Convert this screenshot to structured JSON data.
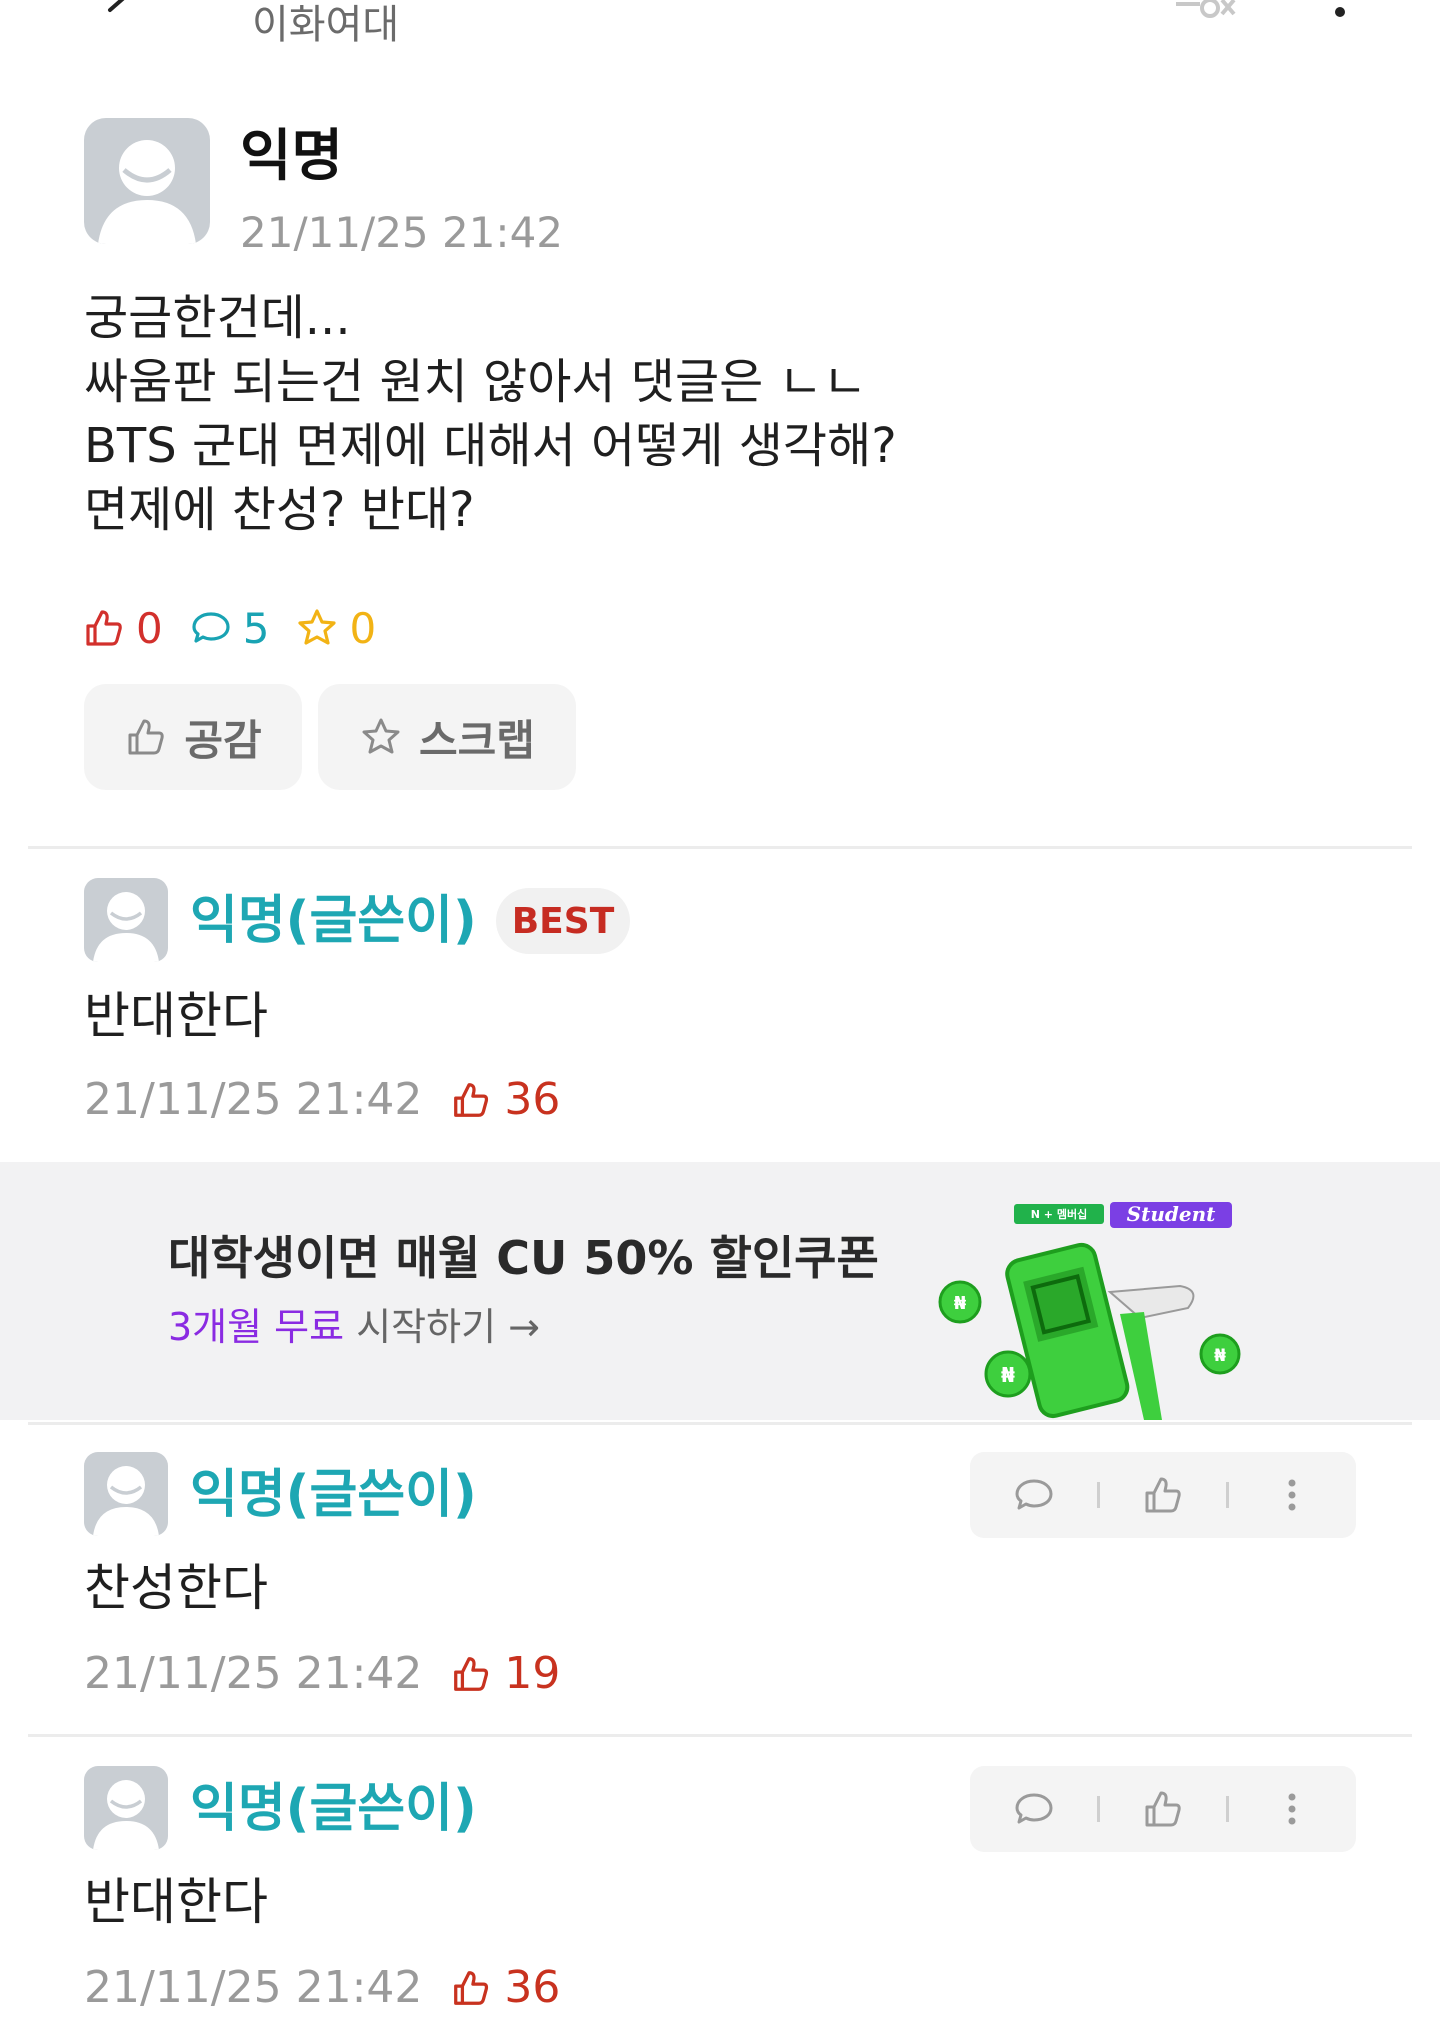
{
  "header": {
    "board_title": "이화여대"
  },
  "post": {
    "author": "익명",
    "date": "21/11/25 21:42",
    "body_lines": [
      "궁금한건데...",
      "싸움판 되는건 원치 않아서 댓글은 ㄴㄴ",
      "BTS 군대 면제에 대해서 어떻게 생각해?",
      "면제에 찬성? 반대?"
    ],
    "stats": {
      "likes": "0",
      "comments": "5",
      "scraps": "0"
    },
    "buttons": {
      "like_label": "공감",
      "scrap_label": "스크랩"
    }
  },
  "comments": [
    {
      "author": "익명(글쓴이)",
      "badge": "BEST",
      "body": "반대한다",
      "date": "21/11/25 21:42",
      "likes": "36"
    },
    {
      "author": "익명(글쓴이)",
      "body": "찬성한다",
      "date": "21/11/25 21:42",
      "likes": "19"
    },
    {
      "author": "익명(글쓴이)",
      "body": "반대한다",
      "date": "21/11/25 21:42",
      "likes": "36"
    }
  ],
  "ad": {
    "headline": "대학생이면 매월 CU 50% 할인쿠폰",
    "sub_accent": "3개월 무료",
    "sub_rest": " 시작하기 →",
    "logo_small": "N + 멤버십",
    "logo_student": "Student"
  },
  "colors": {
    "like": "#d2302c",
    "comment": "#19a3b3",
    "scrap": "#f2b315",
    "author_teal": "#1ea7b3",
    "best_red": "#c62c22",
    "ad_accent": "#8a2be2",
    "ad_green": "#3ecf3e"
  }
}
